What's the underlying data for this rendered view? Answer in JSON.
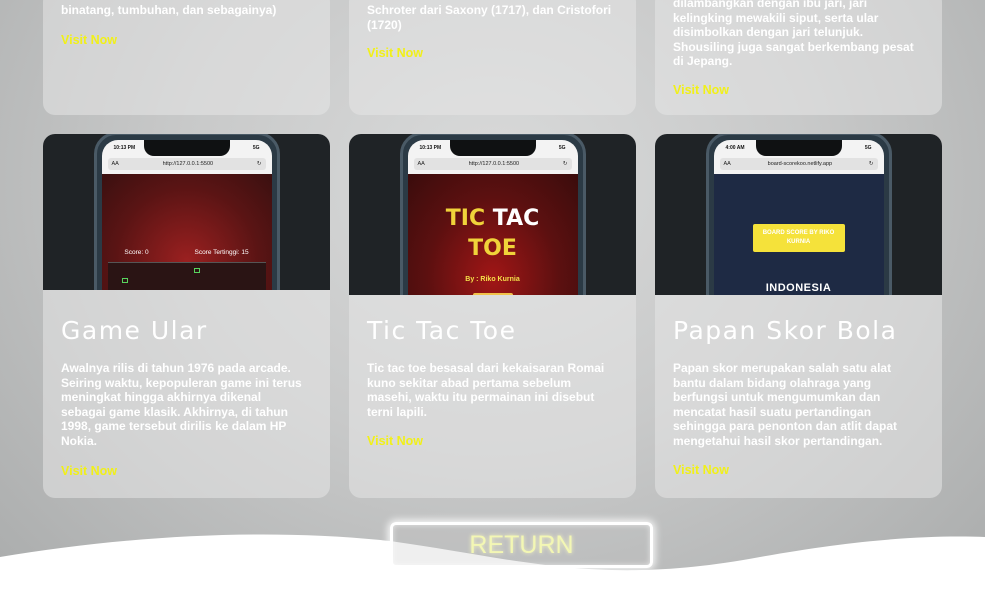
{
  "top_cards": [
    {
      "desc": "binatang, tumbuhan, dan sebagainya)",
      "link": "Visit Now"
    },
    {
      "desc": "Schroter dari Saxony (1717), dan Cristofori (1720)",
      "link": "Visit Now"
    },
    {
      "desc": "dilambangkan dengan ibu jari, jari kelingking mewakili siput, serta ular disimbolkan dengan jari telunjuk. Shousiling juga sangat berkembang pesat di Jepang.",
      "link": "Visit Now"
    }
  ],
  "cards": [
    {
      "title": "Game Ular",
      "desc": "Awalnya rilis di tahun 1976 pada arcade. Seiring waktu, kepopuleran game ini terus meningkat hingga akhirnya dikenal sebagai game klasik. Akhirnya, di tahun 1998, game tersebut dirilis ke dalam HP Nokia.",
      "link": "Visit Now",
      "phone": {
        "time": "10:13 PM",
        "signal": "5G",
        "url": "http://127.0.0.1:5500",
        "score": "Score: 0",
        "high_score": "Score Tertinggi: 15"
      }
    },
    {
      "title": "Tic Tac Toe",
      "desc": "Tic tac toe besasal dari kekaisaran Romai kuno sekitar abad pertama sebelum masehi, waktu itu permainan ini disebut terni lapili.",
      "link": "Visit Now",
      "phone": {
        "time": "10:13 PM",
        "signal": "5G",
        "url": "http://127.0.0.1:5500",
        "title_1": "TIC",
        "title_2": "TAC",
        "title_3": "TOE",
        "byline": "By : Riko Kurnia"
      }
    },
    {
      "title": "Papan Skor Bola",
      "desc": "Papan skor merupakan salah satu alat bantu dalam bidang olahraga yang berfungsi untuk mengumumkan dan mencatat hasil suatu pertandingan sehingga para penonton dan atlit dapat mengetahui hasil skor pertandingan.",
      "link": "Visit Now",
      "phone": {
        "time": "4:00 AM",
        "signal": "5G",
        "url": "board-scorekoo.netlify.app",
        "button": "BOARD SCORE BY RIKO KURNIA",
        "country": "INDONESIA"
      }
    }
  ],
  "return_label": "RETURN",
  "colors": {
    "accent": "#f1f019",
    "return_text": "#f3f7b4"
  }
}
